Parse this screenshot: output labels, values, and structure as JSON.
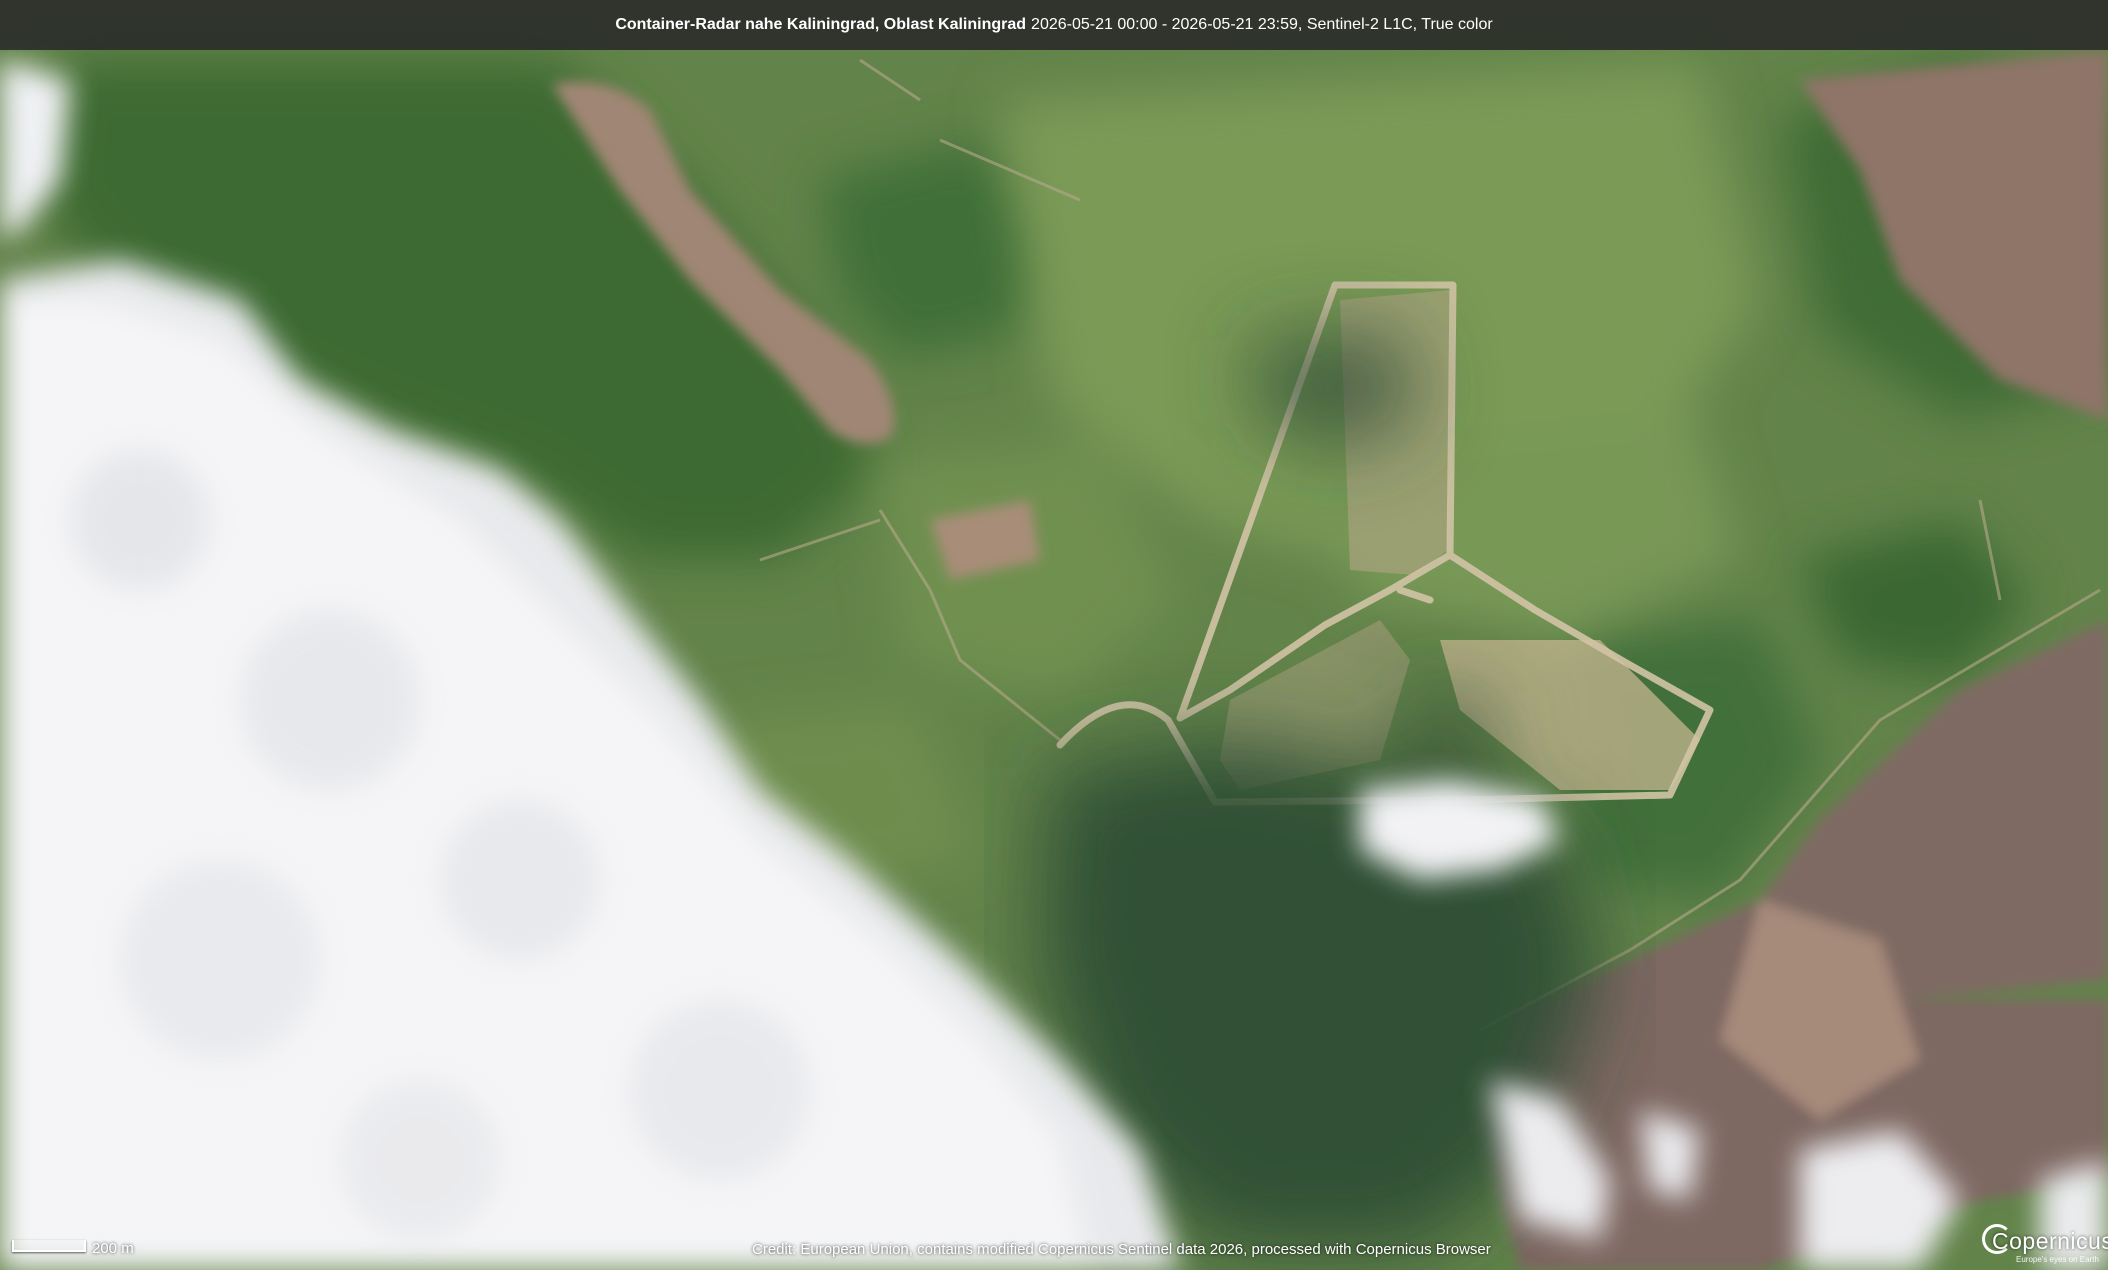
{
  "header": {
    "location": "Container-Radar nahe Kaliningrad, Oblast Kaliningrad",
    "details": "2026-05-21 00:00 - 2026-05-21 23:59, Sentinel-2 L1C, True color"
  },
  "scale": {
    "label": "200 m"
  },
  "credit": "Credit: European Union, contains modified Copernicus Sentinel data 2026, processed with Copernicus Browser",
  "logo": {
    "name": "Copernicus",
    "tagline": "Europe's eyes on Earth"
  },
  "colors": {
    "forest": "#3f6e36",
    "meadow": "#6a8c4c",
    "field": "#8a6d63",
    "soil_light": "#b39a84",
    "road": "#cdbfa3",
    "cloud": "#f4f4f6",
    "cloud_shadow": "#2c4a33"
  }
}
